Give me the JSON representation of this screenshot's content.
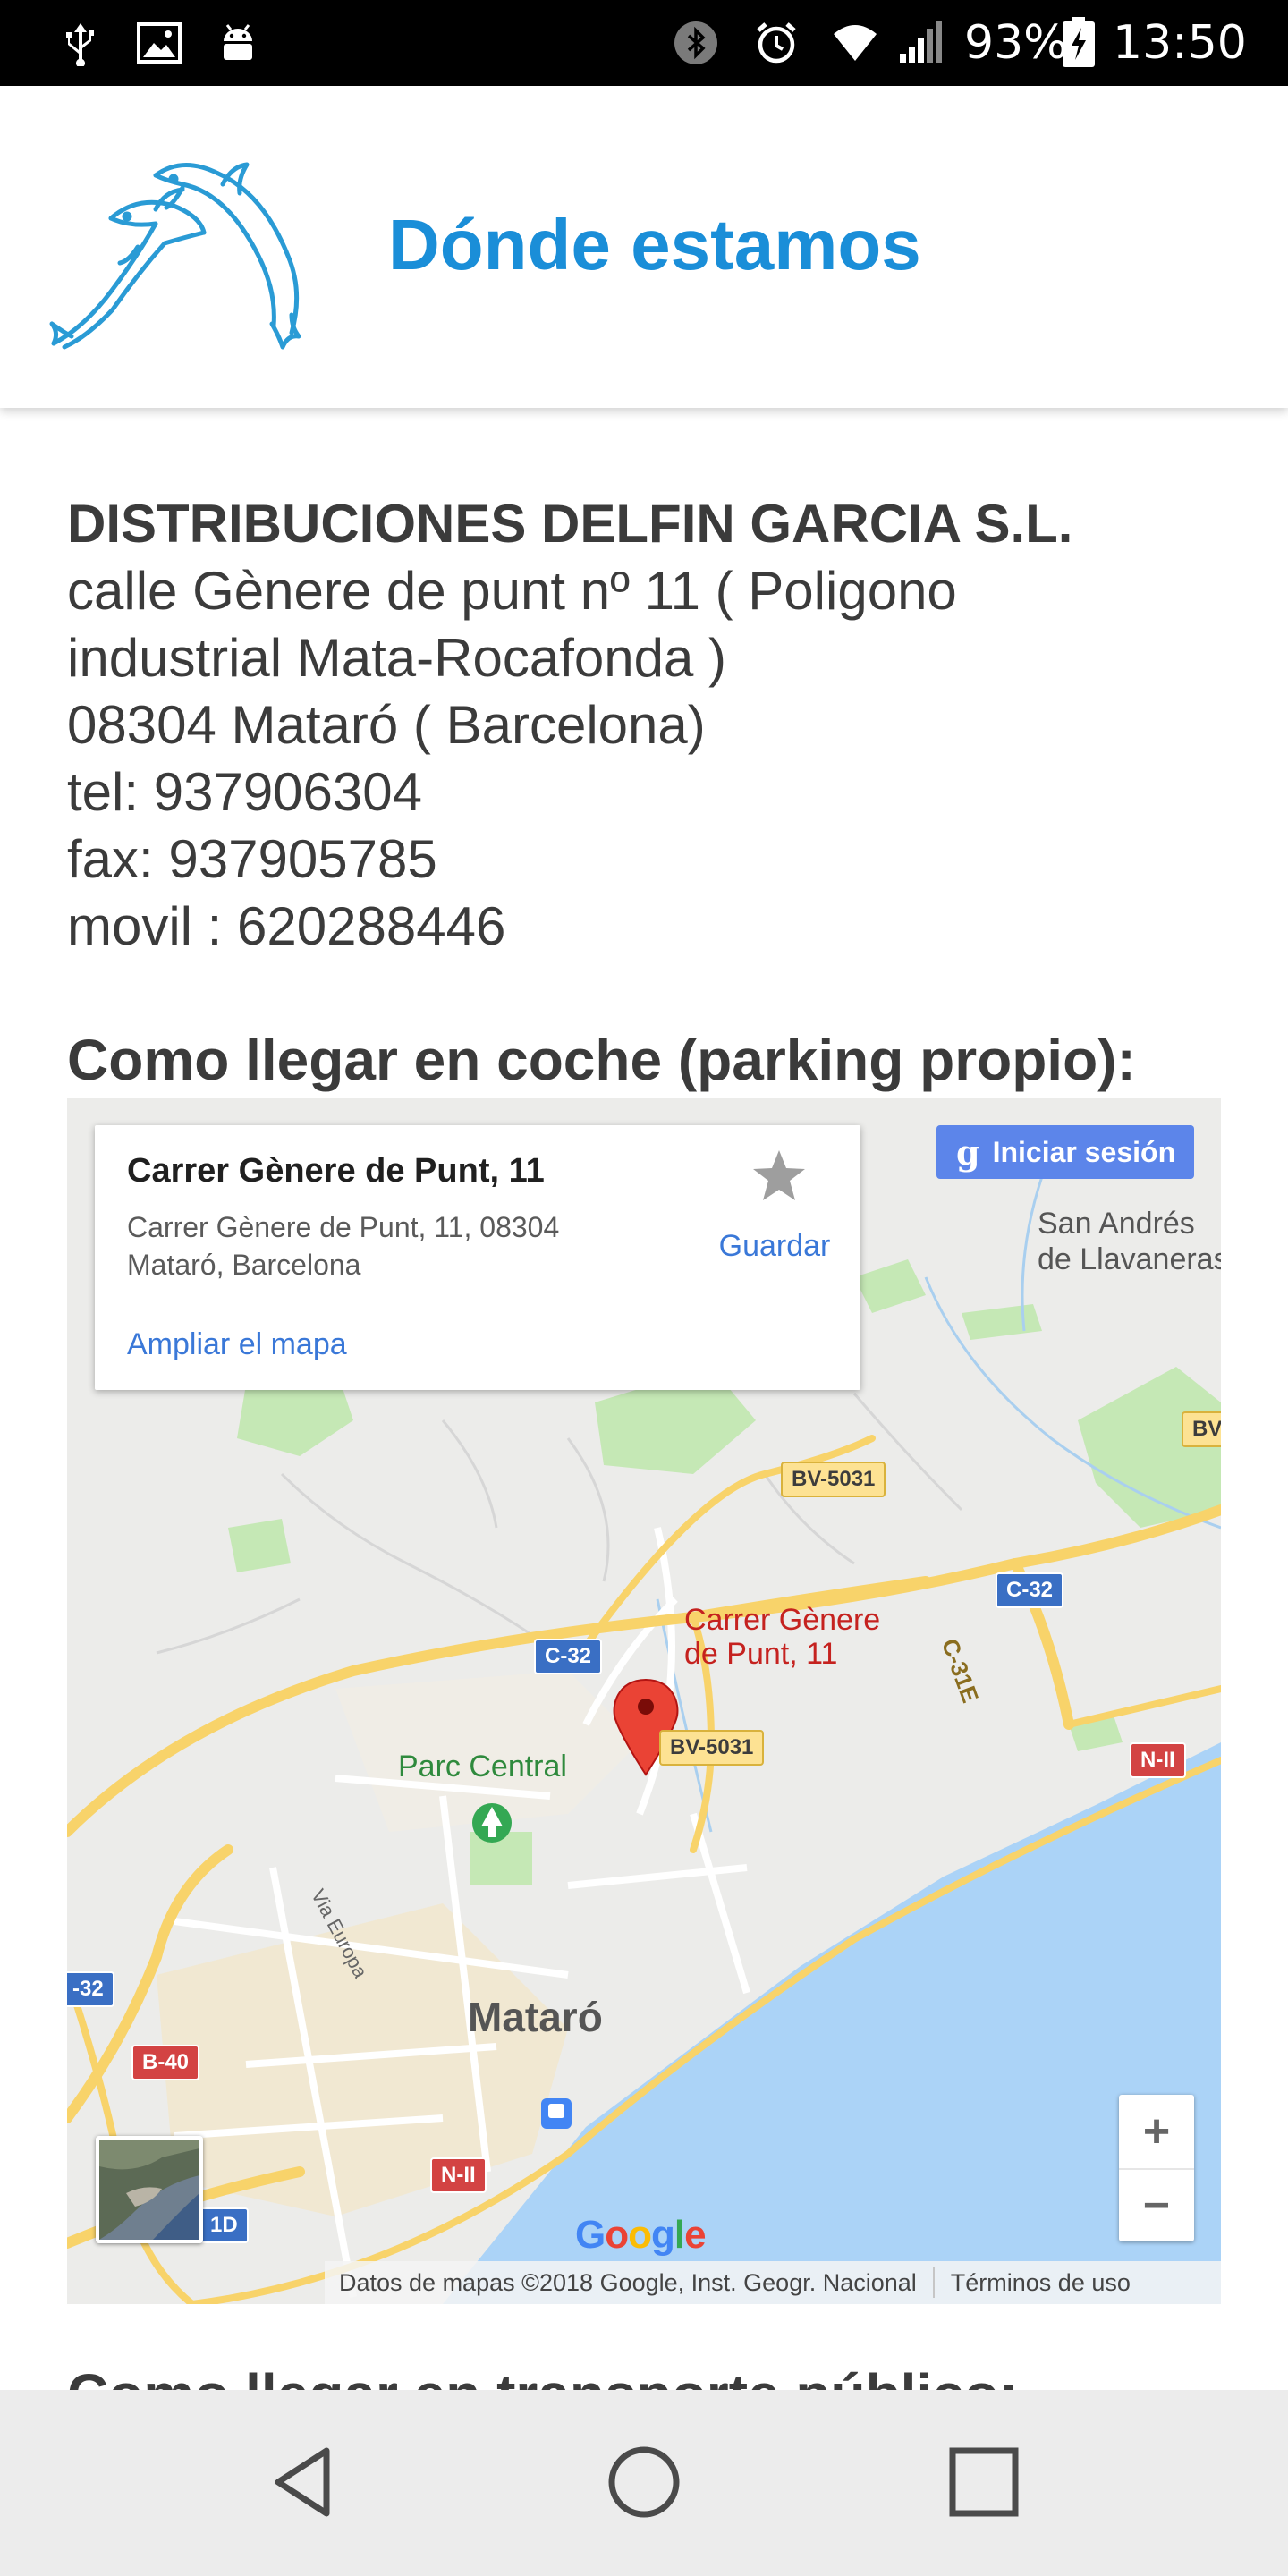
{
  "status_bar": {
    "battery_percent": "93%",
    "time": "13:50",
    "icons": [
      "usb-icon",
      "image-icon",
      "android-icon",
      "bluetooth-icon",
      "alarm-icon",
      "wifi-icon",
      "signal-icon",
      "battery-icon"
    ]
  },
  "header": {
    "title": "Dónde estamos",
    "logo": "dolphins-logo"
  },
  "company": {
    "name": "DISTRIBUCIONES DELFIN GARCIA S.L.",
    "address_line1": "calle Gènere de punt nº 11 ( Poligono",
    "address_line2": "industrial Mata-Rocafonda )",
    "city": "08304 Mataró ( Barcelona)",
    "tel": "tel: 937906304",
    "fax": "fax: 937905785",
    "mobile": "movil : 620288446"
  },
  "sections": {
    "by_car": "Como llegar en coche (parking propio):",
    "by_public_transport": "Como llegar en transporte público:"
  },
  "map": {
    "place_card": {
      "name": "Carrer Gènere de Punt, 11",
      "address_line1": "Carrer Gènere de Punt, 11, 08304",
      "address_line2": "Mataró, Barcelona",
      "enlarge_link": "Ampliar el mapa",
      "save_label": "Guardar"
    },
    "signin_label": "Iniciar sesión",
    "signin_icon": "g",
    "marker_label_line1": "Carrer Gènere",
    "marker_label_line2": "de Punt, 11",
    "labels": {
      "city": "Mataró",
      "park": "Parc Central",
      "town_line1": "San Andrés",
      "town_line2": "de Llavaneras",
      "street": "Via Europa"
    },
    "road_shields": {
      "bv5031_top": "BV-5031",
      "bv5031_mid": "BV-5031",
      "bv_right": "BV-",
      "c32_right": "C-32",
      "c32_center": "C-32",
      "c32_left": "-32",
      "c31e": "C-31E",
      "n2_right": "N-II",
      "n2_bottom": "N-II",
      "b40": "B-40",
      "b1d": "1D"
    },
    "zoom_in": "+",
    "zoom_out": "−",
    "google_logo": "Google",
    "attribution": "Datos de mapas ©2018 Google, Inst. Geogr. Nacional",
    "terms": "Términos de uso",
    "colors": {
      "water": "#abd3f7",
      "land": "#ececea",
      "green": "#c5e8b5",
      "highway": "#f8d36a",
      "marker": "#ea4335",
      "urban": "#f3e7c8"
    }
  },
  "nav_bar": {
    "back": "back-triangle-icon",
    "home": "home-circle-icon",
    "recents": "recents-square-icon"
  },
  "colors": {
    "title": "#1a8ed8",
    "text": "#3b3b3b",
    "link": "#3a78d8"
  }
}
